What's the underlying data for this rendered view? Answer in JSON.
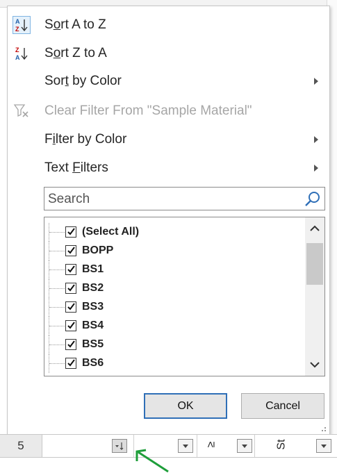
{
  "menu": {
    "items": [
      {
        "label_pre": "S",
        "label_ul": "o",
        "label_post": "rt A to Z",
        "icon": "sort-a-to-z-icon"
      },
      {
        "label_pre": "S",
        "label_ul": "o",
        "label_post": "rt Z to A",
        "icon": "sort-z-to-a-icon"
      },
      {
        "label_pre": "Sor",
        "label_ul": "t",
        "label_post": " by Color",
        "icon": "",
        "submenu": true
      },
      {
        "label_pre": "Clear Filter From \"Sample Material\"",
        "label_ul": "",
        "label_post": "",
        "icon": "clear-filter-icon",
        "disabled": true
      },
      {
        "label_pre": "F",
        "label_ul": "i",
        "label_post": "lter by Color",
        "icon": "",
        "submenu": true
      },
      {
        "label_pre": "Text ",
        "label_ul": "F",
        "label_post": "ilters",
        "icon": "",
        "submenu": true
      }
    ],
    "search_placeholder": "Search",
    "list_items": [
      "(Select All)",
      "BOPP",
      "BS1",
      "BS2",
      "BS3",
      "BS4",
      "BS5",
      "BS6"
    ],
    "ok_label": "OK",
    "cancel_label": "Cancel"
  },
  "sheet": {
    "row_number": "5",
    "header_glyphs": [
      "≥",
      "St"
    ]
  },
  "colors": {
    "accent": "#2f6fb7",
    "arrow_annotation": "#1e9e3a"
  }
}
